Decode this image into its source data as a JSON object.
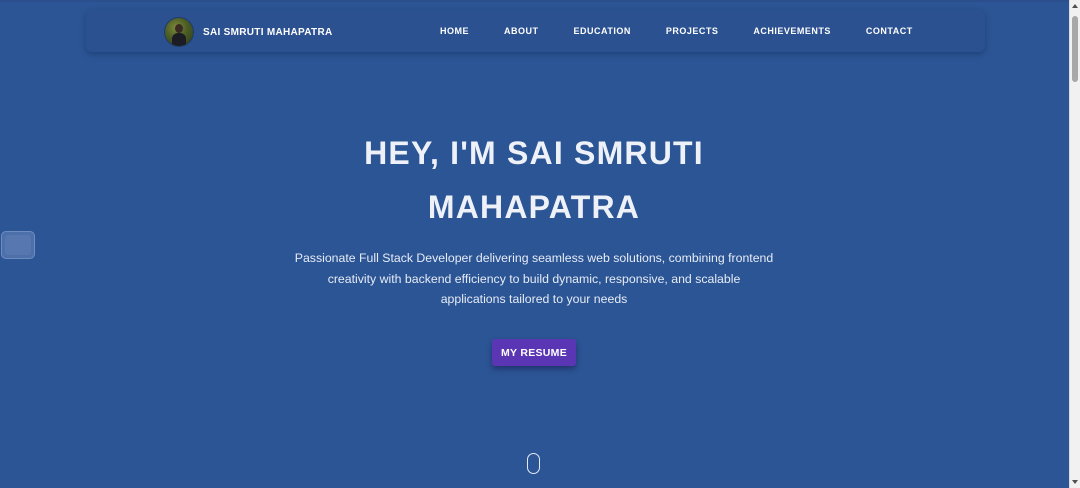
{
  "navbar": {
    "brand_name": "SAI SMRUTI MAHAPATRA",
    "avatar_icon": "profile-photo",
    "links": [
      "HOME",
      "ABOUT",
      "EDUCATION",
      "PROJECTS",
      "ACHIEVEMENTS",
      "CONTACT"
    ]
  },
  "hero": {
    "title_line1": "HEY, I'M SAI SMRUTI",
    "title_line2": "MAHAPATRA",
    "description_line1": "Passionate Full Stack Developer delivering seamless web solutions, combining frontend",
    "description_line2": "creativity with backend efficiency to build dynamic, responsive, and scalable",
    "description_line3": "applications tailored to your needs",
    "resume_button": "MY RESUME"
  },
  "colors": {
    "background": "#2c5595",
    "navbar": "#2b5190",
    "button": "#5a36b5",
    "text": "#ffffff"
  },
  "icons": {
    "scroll_indicator": "mouse-scroll-icon",
    "side_widget": "floating-widget-icon"
  }
}
